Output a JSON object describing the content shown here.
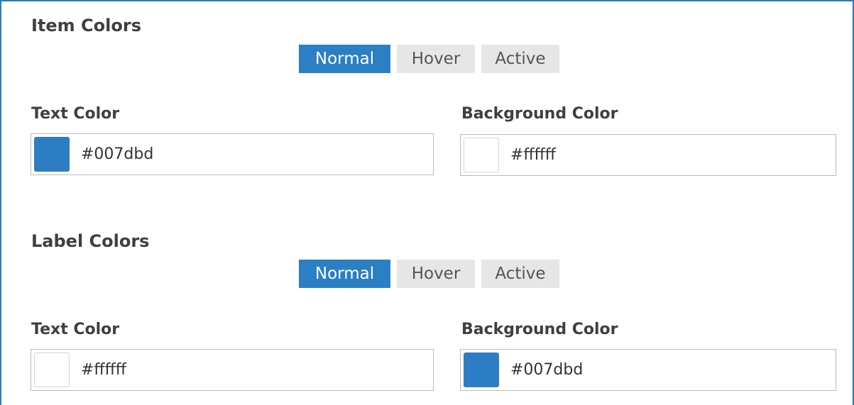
{
  "item_colors": {
    "title": "Item Colors",
    "tabs": {
      "normal": "Normal",
      "hover": "Hover",
      "active": "Active"
    },
    "text_color": {
      "label": "Text Color",
      "value": "#007dbd",
      "swatch": "#2d7dc5"
    },
    "background_color": {
      "label": "Background Color",
      "value": "#ffffff",
      "swatch": "#ffffff"
    }
  },
  "label_colors": {
    "title": "Label Colors",
    "tabs": {
      "normal": "Normal",
      "hover": "Hover",
      "active": "Active"
    },
    "text_color": {
      "label": "Text Color",
      "value": "#ffffff",
      "swatch": "#ffffff"
    },
    "background_color": {
      "label": "Background Color",
      "value": "#007dbd",
      "swatch": "#2d7dc5"
    }
  },
  "colors": {
    "accent": "#2b7fc4",
    "frame_border": "#2d7ab8",
    "inactive_tab": "#e6e6e6"
  }
}
